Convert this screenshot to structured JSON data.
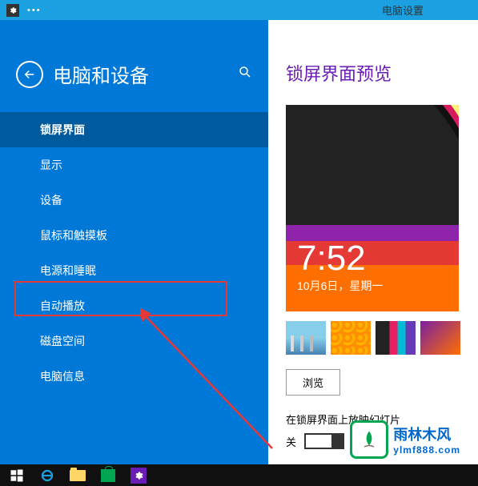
{
  "titlebar": {
    "title": "电脑设置"
  },
  "sidebar": {
    "title": "电脑和设备",
    "items": [
      {
        "label": "锁屏界面",
        "selected": true
      },
      {
        "label": "显示",
        "selected": false
      },
      {
        "label": "设备",
        "selected": false
      },
      {
        "label": "鼠标和触摸板",
        "selected": false
      },
      {
        "label": "电源和睡眠",
        "selected": false
      },
      {
        "label": "自动播放",
        "selected": false
      },
      {
        "label": "磁盘空间",
        "selected": false
      },
      {
        "label": "电脑信息",
        "selected": false
      }
    ]
  },
  "content": {
    "title": "锁屏界面预览",
    "preview": {
      "time": "7:52",
      "date": "10月6日，星期一"
    },
    "browse_label": "浏览",
    "slideshow_label": "在锁屏界面上放映幻灯片",
    "toggle_state": "关"
  },
  "watermark": {
    "name": "雨林木风",
    "url": "ylmf888.com"
  }
}
